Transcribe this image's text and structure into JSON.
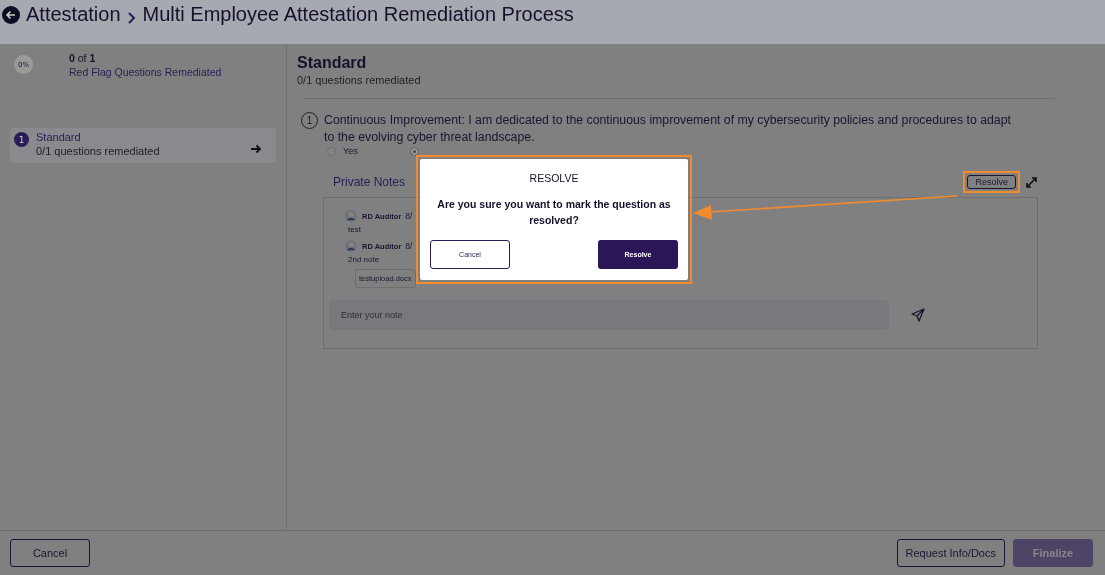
{
  "header": {
    "crumbs": [
      "Attestation",
      "Multi Employee Attestation Remediation Process"
    ]
  },
  "summary": {
    "percent": "0%",
    "count_bold": "0",
    "count_rest": " of ",
    "count_total": "1",
    "label": "Red Flag Questions Remediated"
  },
  "sections": [
    {
      "number": "1",
      "title": "Standard",
      "subtitle": "0/1 questions remediated",
      "selected": true
    }
  ],
  "main": {
    "title": "Standard",
    "subtitle": "0/1 questions remediated"
  },
  "question": {
    "number": "1",
    "text": "Continuous Improvement: I am dedicated to the continuous improvement of my cybersecurity policies and procedures to adapt to the evolving cyber threat landscape.",
    "options": [
      {
        "label": "Yes",
        "selected": false
      },
      {
        "selected": true
      }
    ]
  },
  "notes": {
    "title": "Private Notes",
    "resolve_label": "Resolve",
    "placeholder": "Enter your note",
    "items": [
      {
        "author": "RD Auditor",
        "date": "8/",
        "text": "test"
      },
      {
        "author": "RD Auditor",
        "date": "8/",
        "text": "2nd note",
        "attachment": "testupload.docx"
      }
    ]
  },
  "dialog": {
    "title": "RESOLVE",
    "message": "Are you sure you want to mark the question as resolved?",
    "cancel": "Cancel",
    "confirm": "Resolve"
  },
  "footer": {
    "cancel": "Cancel",
    "request": "Request Info/Docs",
    "finalize": "Finalize"
  }
}
